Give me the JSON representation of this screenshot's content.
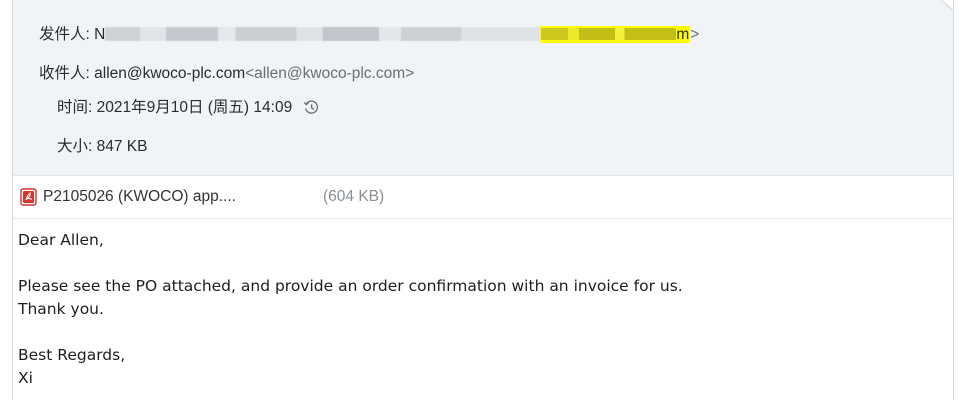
{
  "header": {
    "from_label": "发件人:",
    "from_visible_prefix": "N",
    "from_visible_suffix": "m",
    "from_close": ">",
    "to_label": "收件人:",
    "to_name": "allen@kwoco-plc.com",
    "to_address": "<allen@kwoco-plc.com>",
    "time_label": "时间:",
    "time_value": "2021年9月10日 (周五) 14:09",
    "size_label": "大小:",
    "size_value": "847 KB"
  },
  "attachment": {
    "name": "P2105026 (KWOCO) app....",
    "size": "(604 KB)",
    "icon": "pdf-icon"
  },
  "body": {
    "greeting": "Dear Allen,",
    "line1": "Please see the PO attached, and provide an order confirmation with an invoice for us.",
    "line2": "Thank you.",
    "closing": "Best Regards,",
    "signature_partial": "Xi"
  },
  "colors": {
    "header_bg": "#f1f4f6",
    "highlight": "#ffff00",
    "pdf_red": "#d9342b"
  }
}
